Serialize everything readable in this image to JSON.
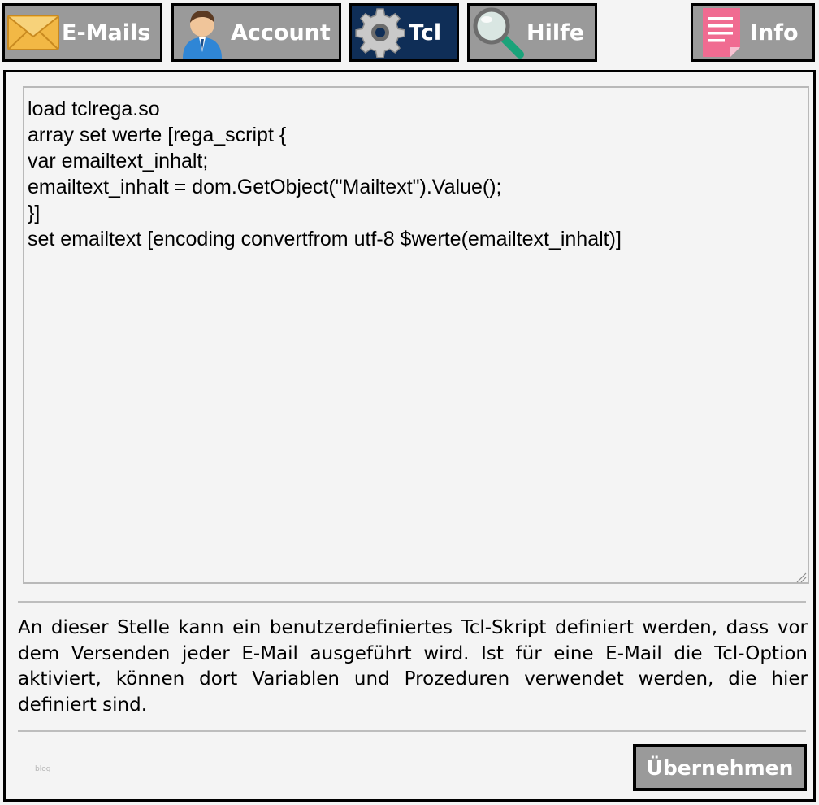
{
  "tabs": {
    "emails": {
      "label": "E-Mails",
      "icon": "envelope-icon"
    },
    "account": {
      "label": "Account",
      "icon": "user-icon"
    },
    "tcl": {
      "label": "Tcl",
      "icon": "gear-icon",
      "active": true
    },
    "hilfe": {
      "label": "Hilfe",
      "icon": "magnifier-icon"
    },
    "info": {
      "label": "Info",
      "icon": "note-icon"
    }
  },
  "editor": {
    "value": "load tclrega.so\narray set werte [rega_script {\nvar emailtext_inhalt;\nemailtext_inhalt = dom.GetObject(\"Mailtext\").Value();\n}]\nset emailtext [encoding convertfrom utf-8 $werte(emailtext_inhalt)]"
  },
  "description": "An dieser Stelle kann ein benutzerdefiniertes Tcl-Skript definiert werden, dass vor dem Versenden jeder E-Mail ausgeführt wird. Ist für eine E-Mail die Tcl-Option aktiviert, können dort Variablen und Prozeduren verwendet werden, die hier definiert sind.",
  "footer_note": "blog",
  "apply_button": {
    "label": "Übernehmen"
  },
  "colors": {
    "tab_bg": "#9a9a9a",
    "tab_active_bg": "#0f2e57",
    "page_bg": "#f4f4f4"
  }
}
